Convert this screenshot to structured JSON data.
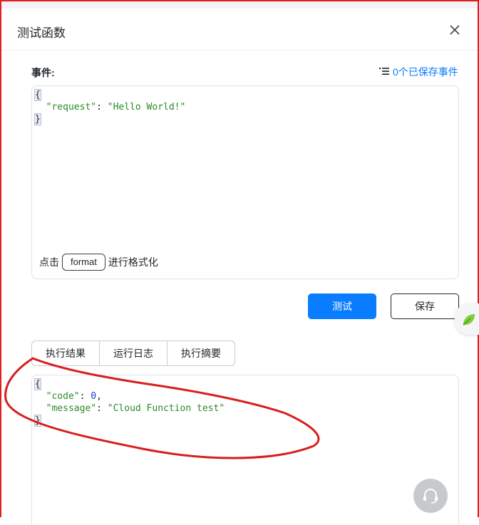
{
  "dialog": {
    "title": "测试函数",
    "close_icon": "close-icon"
  },
  "event": {
    "label": "事件:",
    "saved_events_link": "0个已保存事件",
    "saved_events_icon": "list-icon",
    "code_lines": [
      [
        "{"
      ],
      [
        "  \"request\"",
        ": ",
        "\"Hello World!\""
      ],
      [
        "}"
      ]
    ],
    "format_prefix": "点击",
    "format_button": "format",
    "format_suffix": "进行格式化"
  },
  "actions": {
    "test_label": "测试",
    "save_label": "保存"
  },
  "result_tabs": [
    "执行结果",
    "运行日志",
    "执行摘要"
  ],
  "result": {
    "open_brace": "{",
    "close_brace": "}",
    "code_key": "\"code\"",
    "code_value": "0",
    "message_key": "\"message\"",
    "message_value": "\"Cloud Function test\""
  },
  "colors": {
    "accent": "#0a7cff",
    "annotation": "#e02020",
    "json_string": "#2a8a2a",
    "json_number": "#1a3dcc"
  },
  "icons": {
    "side_widget": "leaf-icon",
    "support": "headset-icon"
  }
}
